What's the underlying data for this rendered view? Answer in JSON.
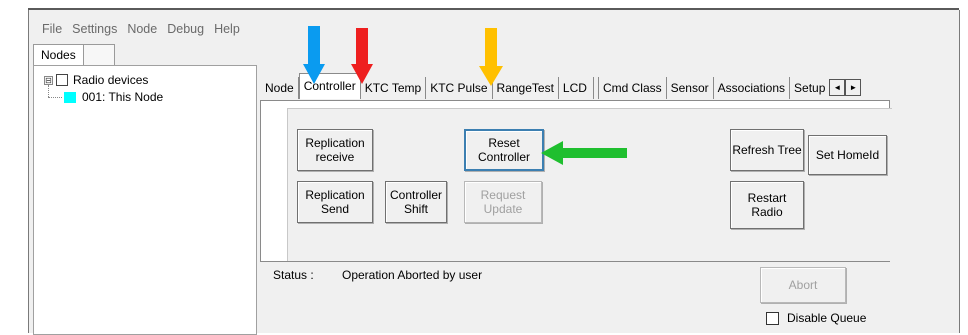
{
  "menu": [
    "File",
    "Settings",
    "Node",
    "Debug",
    "Help"
  ],
  "left_tabs": {
    "active": "Nodes"
  },
  "tree": {
    "root_label": "Radio devices",
    "expander": "⊟",
    "children": [
      {
        "label": "001: This Node",
        "color": "#00ffff"
      }
    ]
  },
  "tabs": [
    "Node",
    "Controller",
    "KTC Temp",
    "KTC Pulse",
    "RangeTest",
    "LCD",
    "Cmd Class",
    "Sensor",
    "Associations",
    "Setup"
  ],
  "active_tab": "Controller",
  "tab_scroll": {
    "left": "◄",
    "right": "►"
  },
  "controller_panel": {
    "replication_receive": "Replication receive",
    "replication_send": "Replication Send",
    "controller_shift": "Controller Shift",
    "reset_controller": "Reset Controller",
    "request_update": "Request Update",
    "refresh_tree": "Refresh Tree",
    "restart_radio": "Restart Radio",
    "set_homeid": "Set HomeId"
  },
  "status": {
    "label": "Status :",
    "value": "Operation Aborted by user"
  },
  "abort_label": "Abort",
  "disable_queue_label": "Disable Queue",
  "annotation_colors": {
    "blue": "#0a9bf0",
    "red": "#ee1f1f",
    "yellow": "#ffc000",
    "green": "#1fbf2f"
  }
}
